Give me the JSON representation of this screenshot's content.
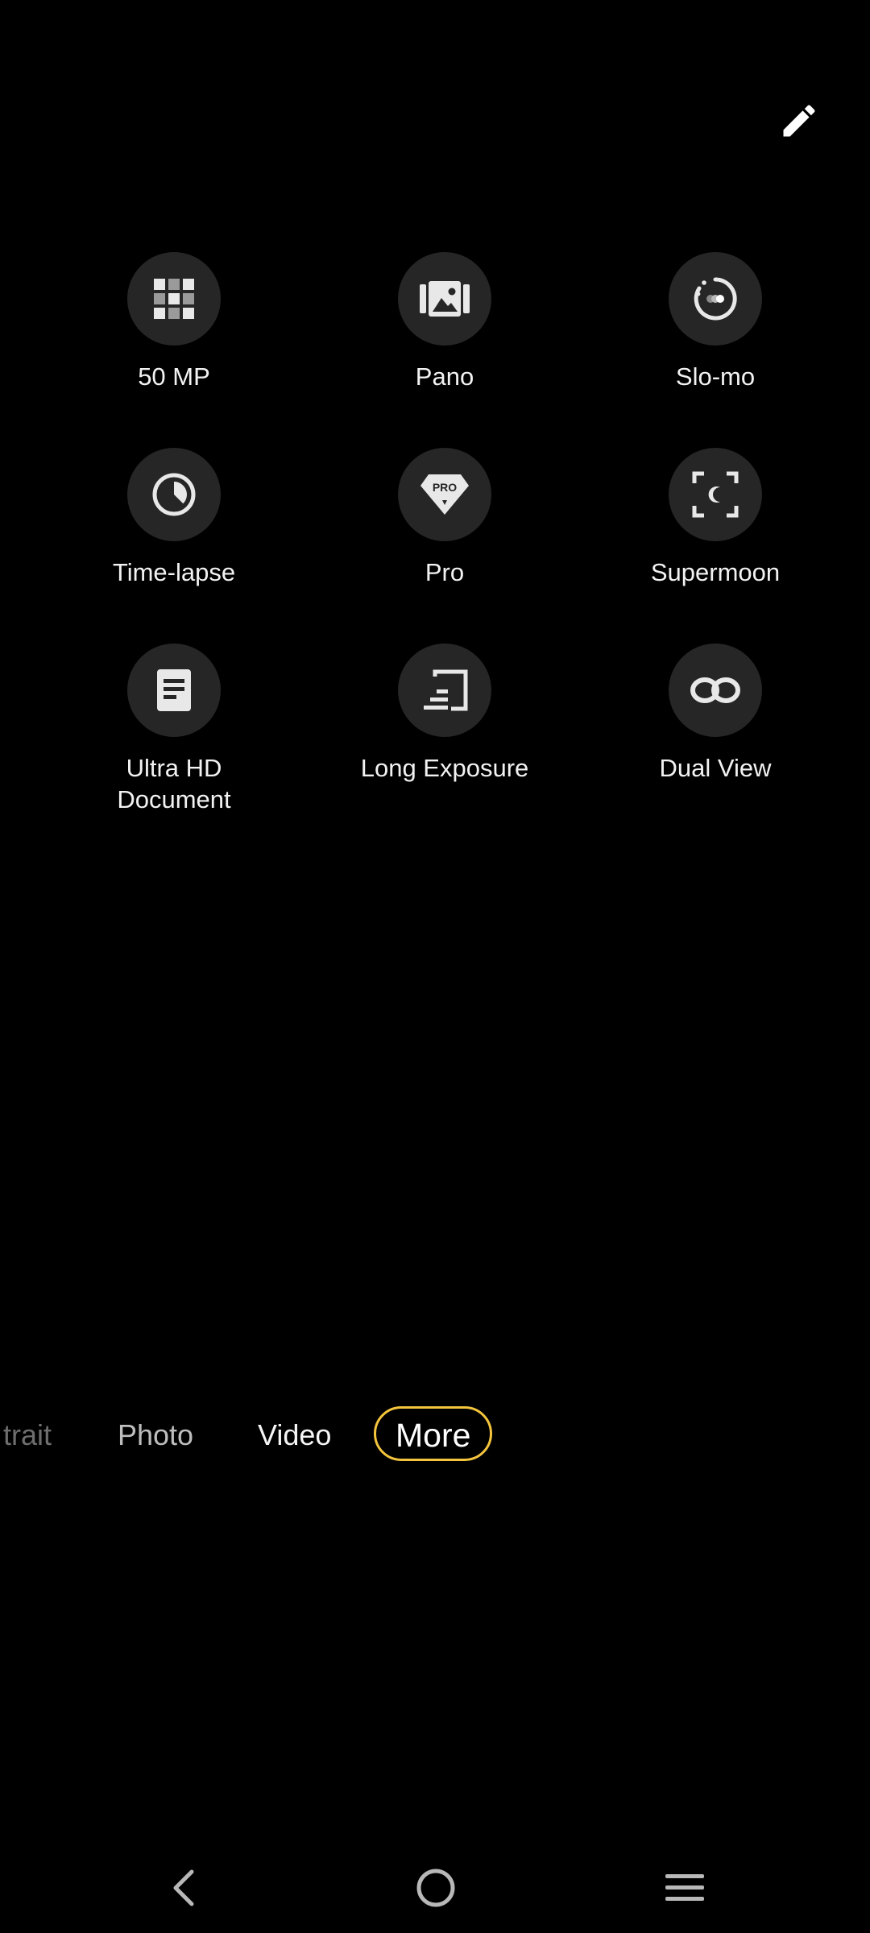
{
  "header": {
    "edit_icon": "pencil-icon"
  },
  "modes": [
    {
      "label": "50 MP",
      "icon": "grid-50mp-icon"
    },
    {
      "label": "Pano",
      "icon": "panorama-icon"
    },
    {
      "label": "Slo-mo",
      "icon": "slow-motion-icon"
    },
    {
      "label": "Time-lapse",
      "icon": "timelapse-clock-icon"
    },
    {
      "label": "Pro",
      "icon": "pro-diamond-icon"
    },
    {
      "label": "Supermoon",
      "icon": "moon-focus-icon"
    },
    {
      "label": "Ultra HD\nDocument",
      "icon": "document-icon"
    },
    {
      "label": "Long Exposure",
      "icon": "long-exposure-icon"
    },
    {
      "label": "Dual View",
      "icon": "dual-view-icon"
    }
  ],
  "mode_bar": {
    "tabs": [
      "trait",
      "Photo",
      "Video",
      "More"
    ],
    "selected": "More",
    "accent_color": "#f3c43c"
  },
  "nav": {
    "back_icon": "back-chevron-icon",
    "home_icon": "home-circle-icon",
    "menu_icon": "recents-menu-icon"
  }
}
